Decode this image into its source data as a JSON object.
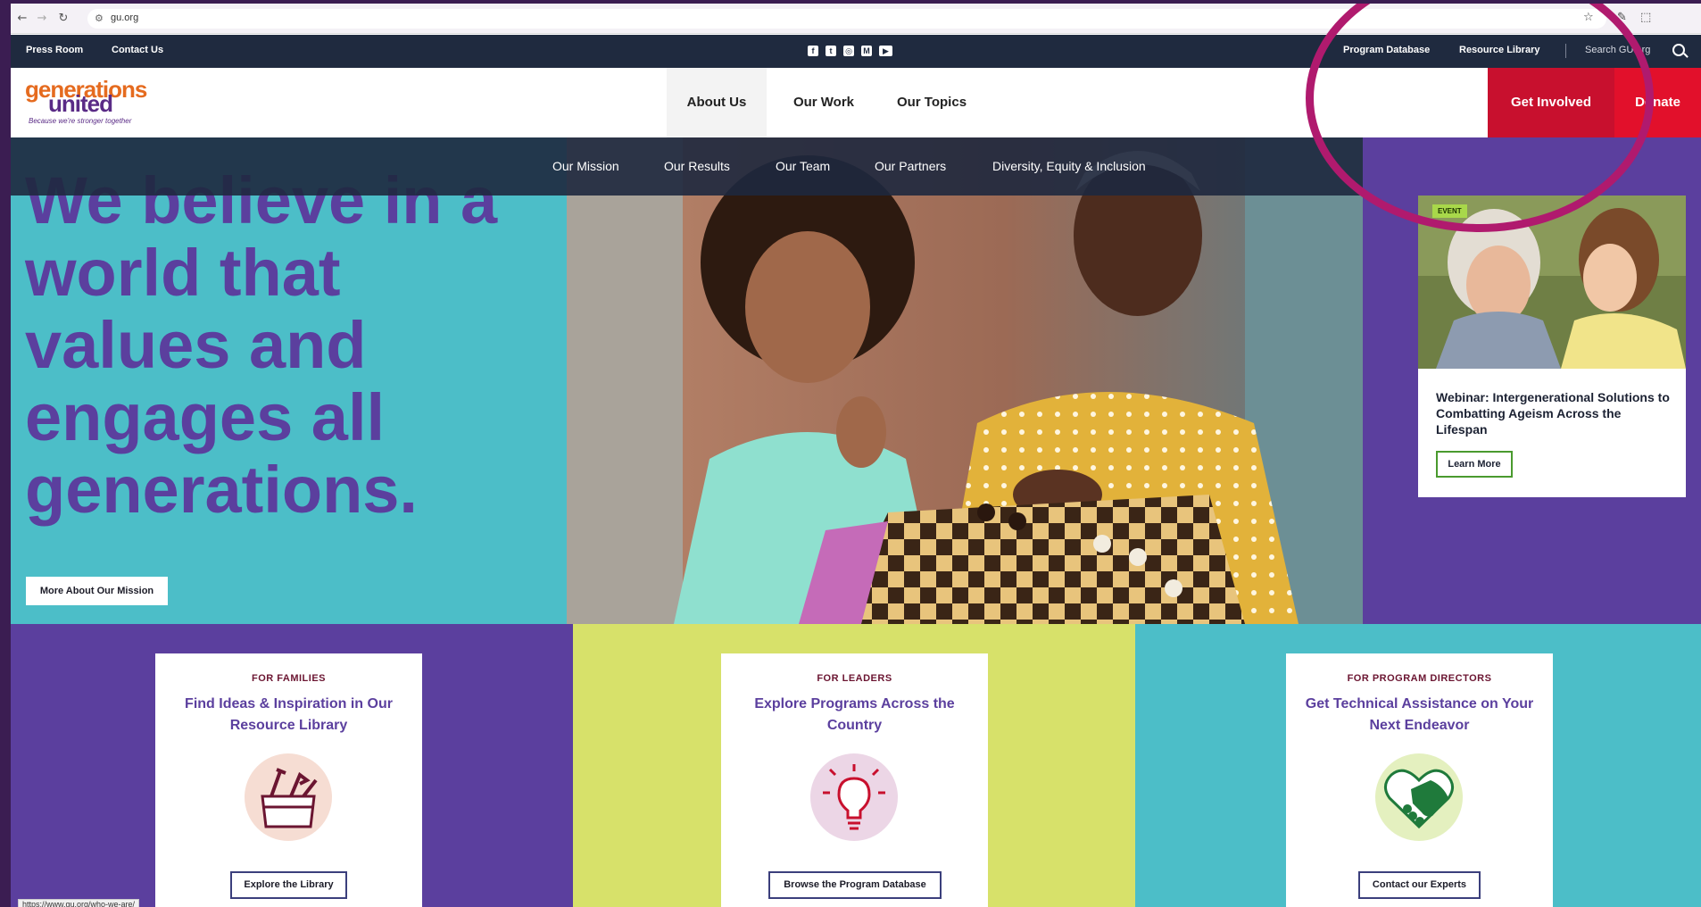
{
  "browser": {
    "url": "gu.org",
    "back_icon": "back-arrow-icon",
    "forward_icon": "forward-arrow-icon",
    "reload_icon": "reload-icon"
  },
  "utility_bar": {
    "press_room": "Press Room",
    "contact_us": "Contact Us",
    "social_icons": [
      "facebook-icon",
      "twitter-icon",
      "instagram-icon",
      "medium-icon",
      "youtube-icon"
    ],
    "program_database": "Program Database",
    "resource_library": "Resource Library",
    "search_placeholder": "Search GU.org"
  },
  "logo": {
    "top": "generations",
    "bottom": "united",
    "tagline": "Because we're stronger together"
  },
  "main_nav": {
    "items": [
      "About Us",
      "Our Work",
      "Our Topics"
    ],
    "get_involved": "Get Involved",
    "donate": "Donate"
  },
  "sub_nav": {
    "items": [
      "Our Mission",
      "Our Results",
      "Our Team",
      "Our Partners",
      "Diversity, Equity & Inclusion"
    ]
  },
  "hero": {
    "headline": "We believe in a world that values and engages all generations.",
    "cta": "More About Our Mission"
  },
  "event": {
    "badge": "EVENT",
    "title": "Webinar: Intergenerational Solutions to Combatting Ageism Across the Lifespan",
    "cta": "Learn More"
  },
  "cards": [
    {
      "kicker": "FOR FAMILIES",
      "title": "Find Ideas & Inspiration in Our Resource Library",
      "icon": "toolbox-icon",
      "cta": "Explore the Library"
    },
    {
      "kicker": "FOR LEADERS",
      "title": "Explore Programs Across the Country",
      "icon": "lightbulb-icon",
      "cta": "Browse the Program Database"
    },
    {
      "kicker": "FOR PROGRAM DIRECTORS",
      "title": "Get Technical Assistance on Your Next Endeavor",
      "icon": "handshake-heart-icon",
      "cta": "Contact our Experts"
    }
  ],
  "status_bar": {
    "hover_url": "https://www.gu.org/who-we-are/"
  },
  "colors": {
    "purple": "#5b3f9e",
    "teal": "#4cbec8",
    "lime": "#d7e16a",
    "red": "#c8102e",
    "navy": "#1f2a3f",
    "annotation": "#b01a6e"
  }
}
